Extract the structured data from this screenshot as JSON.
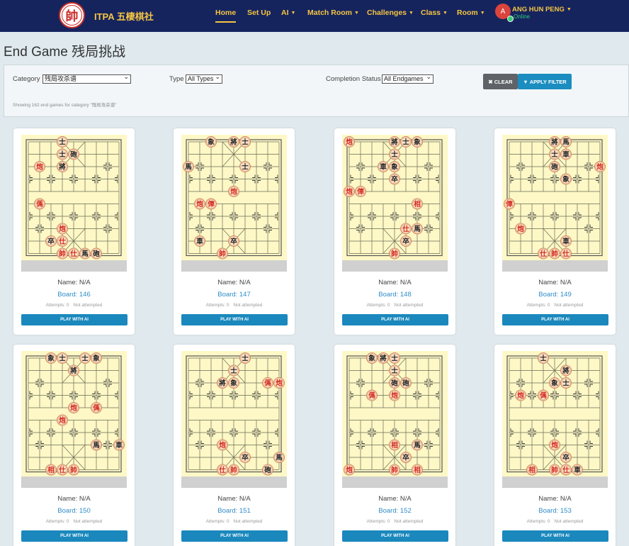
{
  "nav": {
    "logo_char": "帥",
    "brand": "ITPA 五棲棋社",
    "items": [
      {
        "label": "Home",
        "caret": false,
        "active": true
      },
      {
        "label": "Set Up",
        "caret": false,
        "active": false
      },
      {
        "label": "AI",
        "caret": true,
        "active": false
      },
      {
        "label": "Match Room",
        "caret": true,
        "active": false
      },
      {
        "label": "Challenges",
        "caret": true,
        "active": false
      },
      {
        "label": "Class",
        "caret": true,
        "active": false
      },
      {
        "label": "Room",
        "caret": true,
        "active": false
      }
    ],
    "user": {
      "initial": "A",
      "name": "ANG HUN PENG",
      "status": "Online"
    }
  },
  "page": {
    "title": "End Game 残局挑战"
  },
  "filter": {
    "category_label": "Category",
    "category_value": "残局攻杀谱",
    "type_label": "Type",
    "type_value": "All Types",
    "status_label": "Completion Status",
    "status_value": "All Endgames",
    "clear_label": "CLEAR",
    "apply_label": "APPLY FILTER",
    "note": "Showing 162 end games for category \"残局攻杀谱\""
  },
  "card_labels": {
    "play_button": "PLAY WITH AI"
  },
  "cards": [
    {
      "name": "Name: N/A",
      "board": "Board: 146",
      "attempts": "Attempts: 0",
      "status": "Not attempted",
      "pieces": [
        [
          "士",
          3,
          0,
          "b"
        ],
        [
          "士",
          3,
          1,
          "b"
        ],
        [
          "砲",
          4,
          1,
          "b"
        ],
        [
          "將",
          3,
          2,
          "b"
        ],
        [
          "炮",
          1,
          2,
          "r"
        ],
        [
          "傌",
          1,
          5,
          "r"
        ],
        [
          "炮",
          3,
          7,
          "r"
        ],
        [
          "卒",
          2,
          8,
          "b"
        ],
        [
          "仕",
          3,
          8,
          "r"
        ],
        [
          "帥",
          3,
          9,
          "r"
        ],
        [
          "仕",
          4,
          9,
          "r"
        ],
        [
          "馬",
          5,
          9,
          "b"
        ],
        [
          "砲",
          6,
          9,
          "b"
        ]
      ]
    },
    {
      "name": "Name: N/A",
      "board": "Board: 147",
      "attempts": "Attempts: 0",
      "status": "Not attempted",
      "pieces": [
        [
          "象",
          2,
          0,
          "b"
        ],
        [
          "將",
          4,
          0,
          "b"
        ],
        [
          "士",
          5,
          0,
          "b"
        ],
        [
          "士",
          5,
          2,
          "b"
        ],
        [
          "馬",
          0,
          2,
          "b"
        ],
        [
          "炮",
          4,
          4,
          "r"
        ],
        [
          "炮",
          1,
          5,
          "r"
        ],
        [
          "俥",
          2,
          5,
          "r"
        ],
        [
          "車",
          1,
          8,
          "b"
        ],
        [
          "卒",
          4,
          8,
          "b"
        ],
        [
          "帥",
          3,
          9,
          "r"
        ]
      ]
    },
    {
      "name": "Name: N/A",
      "board": "Board: 148",
      "attempts": "Attempts: 0",
      "status": "Not attempted",
      "pieces": [
        [
          "炮",
          0,
          0,
          "r"
        ],
        [
          "將",
          4,
          0,
          "b"
        ],
        [
          "士",
          5,
          0,
          "b"
        ],
        [
          "象",
          6,
          0,
          "b"
        ],
        [
          "士",
          4,
          1,
          "b"
        ],
        [
          "車",
          3,
          2,
          "b"
        ],
        [
          "象",
          4,
          2,
          "b"
        ],
        [
          "卒",
          4,
          3,
          "b"
        ],
        [
          "炮",
          0,
          4,
          "r"
        ],
        [
          "俥",
          1,
          4,
          "r"
        ],
        [
          "相",
          6,
          5,
          "r"
        ],
        [
          "仕",
          5,
          7,
          "r"
        ],
        [
          "馬",
          6,
          7,
          "b"
        ],
        [
          "卒",
          5,
          8,
          "b"
        ],
        [
          "帥",
          4,
          9,
          "r"
        ]
      ]
    },
    {
      "name": "Name: N/A",
      "board": "Board: 149",
      "attempts": "Attempts: 0",
      "status": "Not attempted",
      "pieces": [
        [
          "將",
          4,
          0,
          "b"
        ],
        [
          "馬",
          5,
          0,
          "b"
        ],
        [
          "士",
          4,
          1,
          "b"
        ],
        [
          "車",
          5,
          1,
          "b"
        ],
        [
          "砲",
          4,
          2,
          "b"
        ],
        [
          "炮",
          8,
          2,
          "r"
        ],
        [
          "象",
          5,
          3,
          "b"
        ],
        [
          "俥",
          0,
          5,
          "r"
        ],
        [
          "炮",
          1,
          7,
          "r"
        ],
        [
          "車",
          5,
          8,
          "b"
        ],
        [
          "仕",
          3,
          9,
          "r"
        ],
        [
          "帥",
          4,
          9,
          "r"
        ],
        [
          "仕",
          5,
          9,
          "r"
        ]
      ]
    },
    {
      "name": "Name: N/A",
      "board": "Board: 150",
      "attempts": "Attempts: 0",
      "status": "Not attempted",
      "pieces": [
        [
          "象",
          2,
          0,
          "b"
        ],
        [
          "士",
          3,
          0,
          "b"
        ],
        [
          "士",
          5,
          0,
          "b"
        ],
        [
          "象",
          6,
          0,
          "b"
        ],
        [
          "將",
          4,
          1,
          "b"
        ],
        [
          "炮",
          4,
          4,
          "r"
        ],
        [
          "傌",
          6,
          4,
          "r"
        ],
        [
          "炮",
          3,
          5,
          "r"
        ],
        [
          "馬",
          6,
          7,
          "b"
        ],
        [
          "車",
          8,
          7,
          "b"
        ],
        [
          "相",
          2,
          9,
          "r"
        ],
        [
          "仕",
          3,
          9,
          "r"
        ],
        [
          "帥",
          4,
          9,
          "r"
        ]
      ]
    },
    {
      "name": "Name: N/A",
      "board": "Board: 151",
      "attempts": "Attempts: 0",
      "status": "Not attempted",
      "pieces": [
        [
          "士",
          5,
          0,
          "b"
        ],
        [
          "士",
          4,
          1,
          "b"
        ],
        [
          "將",
          3,
          2,
          "b"
        ],
        [
          "象",
          4,
          2,
          "b"
        ],
        [
          "傌",
          7,
          2,
          "r"
        ],
        [
          "炮",
          8,
          2,
          "r"
        ],
        [
          "炮",
          3,
          7,
          "r"
        ],
        [
          "卒",
          5,
          8,
          "b"
        ],
        [
          "馬",
          8,
          8,
          "b"
        ],
        [
          "仕",
          3,
          9,
          "r"
        ],
        [
          "帥",
          4,
          9,
          "r"
        ],
        [
          "砲",
          7,
          9,
          "b"
        ]
      ]
    },
    {
      "name": "Name: N/A",
      "board": "Board: 152",
      "attempts": "Attempts: 0",
      "status": "Not attempted",
      "pieces": [
        [
          "象",
          2,
          0,
          "b"
        ],
        [
          "將",
          3,
          0,
          "b"
        ],
        [
          "士",
          4,
          0,
          "b"
        ],
        [
          "士",
          4,
          1,
          "b"
        ],
        [
          "砲",
          4,
          2,
          "b"
        ],
        [
          "砲",
          5,
          2,
          "b"
        ],
        [
          "傌",
          2,
          3,
          "r"
        ],
        [
          "炮",
          4,
          3,
          "r"
        ],
        [
          "相",
          4,
          7,
          "r"
        ],
        [
          "馬",
          6,
          7,
          "b"
        ],
        [
          "卒",
          5,
          8,
          "b"
        ],
        [
          "炮",
          0,
          9,
          "r"
        ],
        [
          "帥",
          4,
          9,
          "r"
        ],
        [
          "相",
          6,
          9,
          "r"
        ]
      ]
    },
    {
      "name": "Name: N/A",
      "board": "Board: 153",
      "attempts": "Attempts: 0",
      "status": "Not attempted",
      "pieces": [
        [
          "士",
          3,
          0,
          "b"
        ],
        [
          "將",
          5,
          1,
          "b"
        ],
        [
          "象",
          4,
          2,
          "b"
        ],
        [
          "士",
          5,
          2,
          "b"
        ],
        [
          "炮",
          1,
          3,
          "r"
        ],
        [
          "傌",
          3,
          3,
          "r"
        ],
        [
          "炮",
          4,
          7,
          "r"
        ],
        [
          "卒",
          5,
          8,
          "b"
        ],
        [
          "相",
          2,
          9,
          "r"
        ],
        [
          "帥",
          4,
          9,
          "r"
        ],
        [
          "仕",
          5,
          9,
          "r"
        ],
        [
          "車",
          6,
          9,
          "b"
        ]
      ]
    }
  ],
  "colors": {
    "navbar": "#16245e",
    "nav_text": "#f5c542",
    "primary": "#1a88bd",
    "board_bg": "#fdf8c6",
    "red_piece": "#d42a1e",
    "black_piece": "#222222"
  }
}
